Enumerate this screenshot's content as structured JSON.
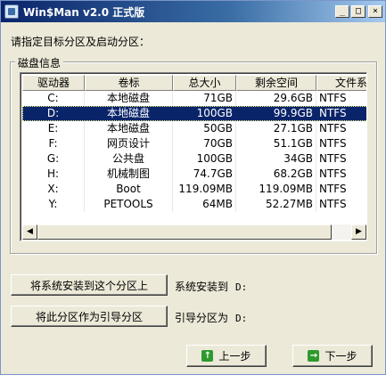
{
  "window": {
    "title": "Win$Man v2.0 正式版",
    "minimize_glyph": "_",
    "maximize_glyph": "□",
    "close_glyph": "×"
  },
  "prompt_text": "请指定目标分区及启动分区：",
  "group_title": "磁盘信息",
  "table": {
    "columns": [
      "驱动器",
      "卷标",
      "总大小",
      "剩余空间",
      "文件系统"
    ],
    "rows": [
      {
        "drive": "C:",
        "label": "本地磁盘",
        "total": "71GB",
        "free": "29.6GB",
        "fs": "NTFS"
      },
      {
        "drive": "D:",
        "label": "本地磁盘",
        "total": "100GB",
        "free": "99.9GB",
        "fs": "NTFS",
        "selected": true
      },
      {
        "drive": "E:",
        "label": "本地磁盘",
        "total": "50GB",
        "free": "27.1GB",
        "fs": "NTFS"
      },
      {
        "drive": "F:",
        "label": "网页设计",
        "total": "70GB",
        "free": "51.1GB",
        "fs": "NTFS"
      },
      {
        "drive": "G:",
        "label": "公共盘",
        "total": "100GB",
        "free": "34GB",
        "fs": "NTFS"
      },
      {
        "drive": "H:",
        "label": "机械制图",
        "total": "74.7GB",
        "free": "68.2GB",
        "fs": "NTFS"
      },
      {
        "drive": "X:",
        "label": "Boot",
        "total": "119.09MB",
        "free": "119.09MB",
        "fs": "NTFS"
      },
      {
        "drive": "Y:",
        "label": "PETOOLS",
        "total": "64MB",
        "free": "52.27MB",
        "fs": "NTFS"
      }
    ]
  },
  "scrollbar": {
    "left_glyph": "◀",
    "right_glyph": "▶"
  },
  "install_button_label": "将系统安装到这个分区上",
  "install_target_label": "系统安装到",
  "install_target_value": "D:",
  "boot_button_label": "将此分区作为引导分区",
  "boot_target_label": "引导分区为",
  "boot_target_value": "D:",
  "prev_button_label": "上一步",
  "prev_icon": "up-arrow-icon",
  "next_button_label": "下一步",
  "next_icon": "right-arrow-icon",
  "accent_color": "#0a246a"
}
